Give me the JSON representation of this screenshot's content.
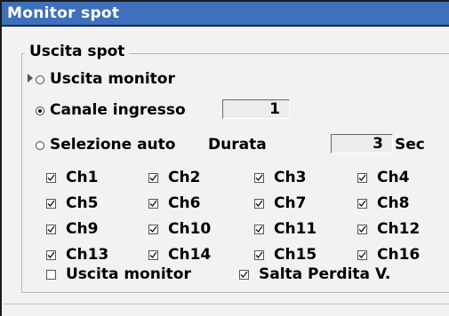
{
  "window": {
    "title": "Monitor spot"
  },
  "group": {
    "title": "Uscita spot"
  },
  "options": {
    "uscita_monitor": {
      "label": "Uscita monitor",
      "selected": false
    },
    "canale_ingresso": {
      "label": "Canale ingresso",
      "value": "1",
      "selected": true
    },
    "selezione_auto": {
      "label": "Selezione auto",
      "selected": false
    },
    "durata": {
      "label": "Durata",
      "value": "3",
      "unit": "Sec"
    }
  },
  "channels": [
    {
      "label": "Ch1",
      "checked": true
    },
    {
      "label": "Ch2",
      "checked": true
    },
    {
      "label": "Ch3",
      "checked": true
    },
    {
      "label": "Ch4",
      "checked": true
    },
    {
      "label": "Ch5",
      "checked": true
    },
    {
      "label": "Ch6",
      "checked": true
    },
    {
      "label": "Ch7",
      "checked": true
    },
    {
      "label": "Ch8",
      "checked": true
    },
    {
      "label": "Ch9",
      "checked": true
    },
    {
      "label": "Ch10",
      "checked": true
    },
    {
      "label": "Ch11",
      "checked": true
    },
    {
      "label": "Ch12",
      "checked": true
    },
    {
      "label": "Ch13",
      "checked": true
    },
    {
      "label": "Ch14",
      "checked": true
    },
    {
      "label": "Ch15",
      "checked": true
    },
    {
      "label": "Ch16",
      "checked": true
    }
  ],
  "bottom_options": {
    "uscita_monitor": {
      "label": "Uscita monitor",
      "checked": false
    },
    "salta_perdita": {
      "label": "Salta Perdita V.",
      "checked": true
    }
  },
  "colors": {
    "titlebar": "#3f70bb",
    "background": "#f2f2f2"
  }
}
